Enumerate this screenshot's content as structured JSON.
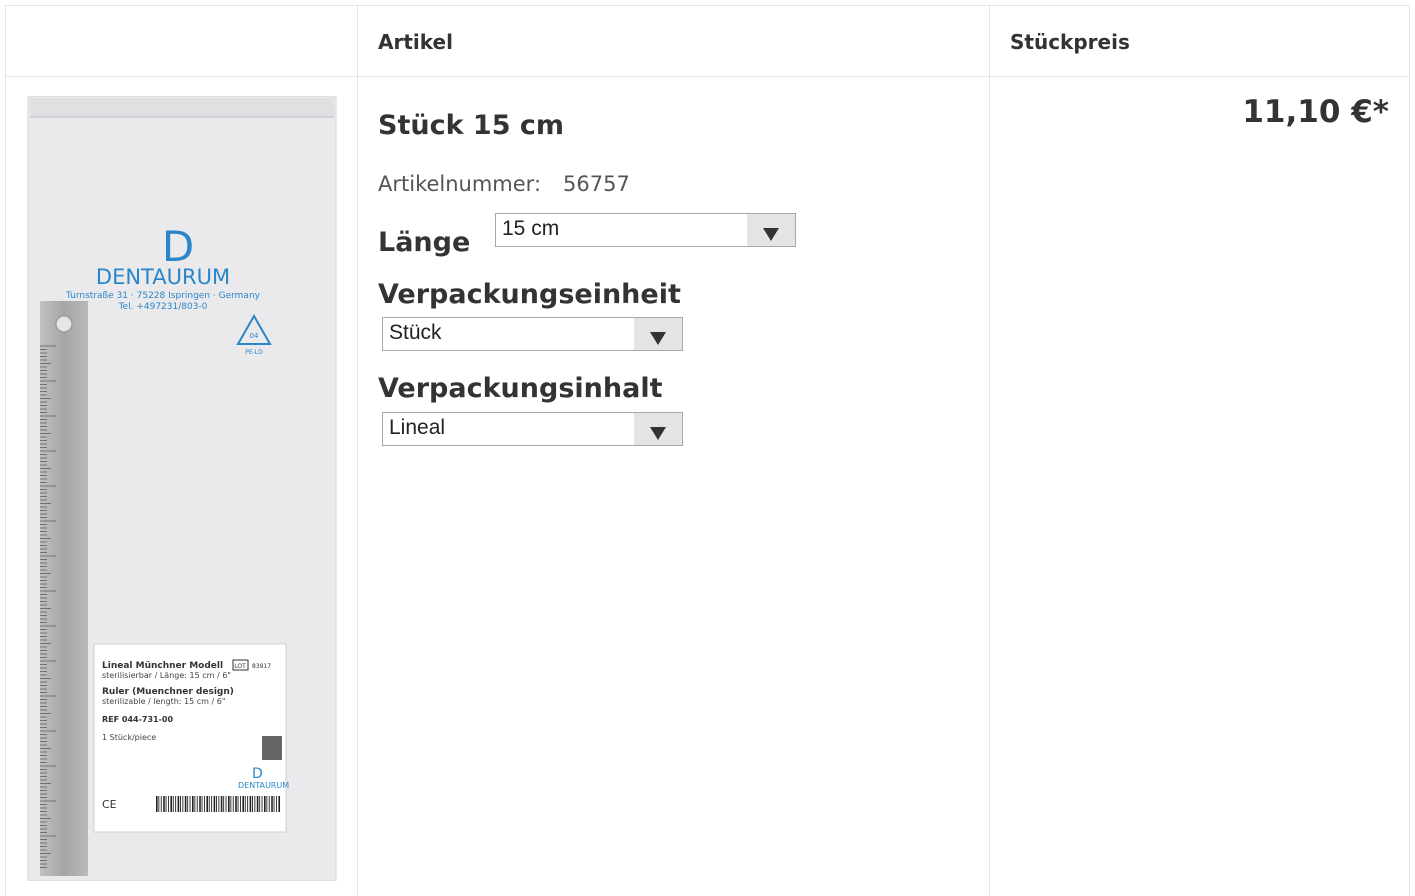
{
  "table": {
    "col_artikel": "Artikel",
    "col_stueckpreis": "Stückpreis"
  },
  "product": {
    "title": "Stück 15 cm",
    "artikelnummer_label": "Artikelnummer:",
    "artikelnummer": "56757",
    "price": "11,10 €*",
    "image": {
      "brand": "DENTAURUM",
      "address": "Turnstraße 31 · 75228 Ispringen · Germany",
      "phone": "Tel. +497231/803-0",
      "recycle_code": "04",
      "recycle_label": "PE-LD",
      "label_name_de": "Lineal Münchner Modell",
      "label_sub_de": "sterilisierbar / Länge: 15 cm / 6\"",
      "label_name_en": "Ruler (Muenchner design)",
      "label_sub_en": "sterilizable / length: 15 cm / 6\"",
      "ref": "REF 044-731-00",
      "qty": "1 Stück/piece",
      "lot": "LOT",
      "lot_no": "83917"
    }
  },
  "options": {
    "laenge": {
      "label": "Länge",
      "selected": "15 cm"
    },
    "verpackungseinheit": {
      "label": "Verpackungseinheit",
      "selected": "Stück"
    },
    "verpackungsinhalt": {
      "label": "Verpackungsinhalt",
      "selected": "Lineal"
    }
  },
  "colors": {
    "brand_blue": "#2a86c9",
    "border": "#e3e3e3",
    "text": "#333333"
  }
}
